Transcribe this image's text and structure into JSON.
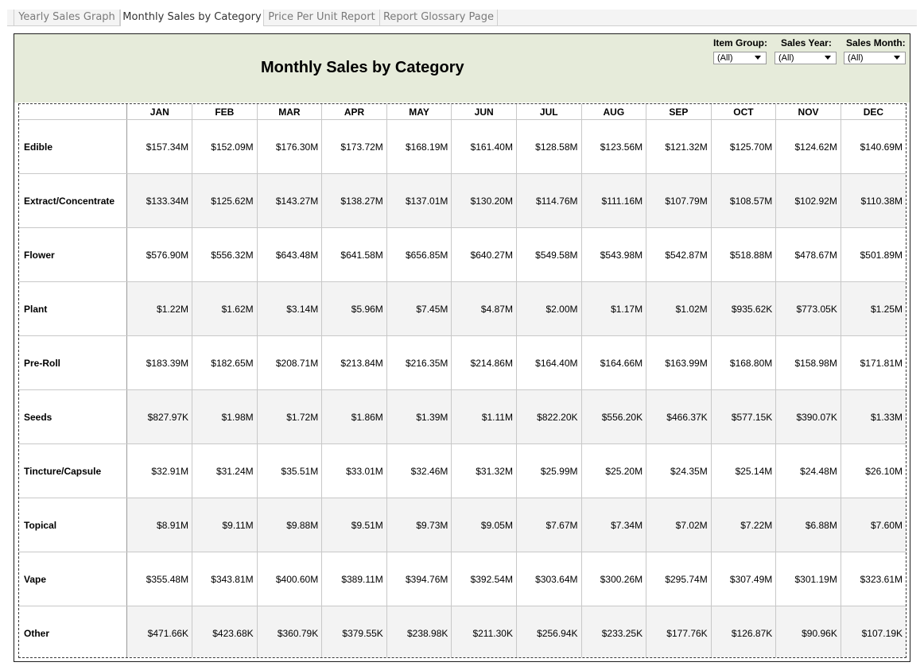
{
  "tabs": [
    {
      "label": "Yearly Sales Graph",
      "active": false
    },
    {
      "label": "Monthly Sales by Category",
      "active": true
    },
    {
      "label": "Price Per Unit Report",
      "active": false
    },
    {
      "label": "Report Glossary Page",
      "active": false
    }
  ],
  "dashboard": {
    "title": "Monthly Sales by Category",
    "header_bg": "#e6ebda",
    "filters": [
      {
        "label": "Item Group:",
        "value": "(All)"
      },
      {
        "label": "Sales Year:",
        "value": "(All)"
      },
      {
        "label": "Sales Month:",
        "value": "(All)"
      }
    ]
  },
  "table": {
    "columns": [
      "JAN",
      "FEB",
      "MAR",
      "APR",
      "MAY",
      "JUN",
      "JUL",
      "AUG",
      "SEP",
      "OCT",
      "NOV",
      "DEC"
    ],
    "rows": [
      {
        "category": "Edible",
        "values": [
          "$157.34M",
          "$152.09M",
          "$176.30M",
          "$173.72M",
          "$168.19M",
          "$161.40M",
          "$128.58M",
          "$123.56M",
          "$121.32M",
          "$125.70M",
          "$124.62M",
          "$140.69M"
        ]
      },
      {
        "category": "Extract/Concentrate",
        "values": [
          "$133.34M",
          "$125.62M",
          "$143.27M",
          "$138.27M",
          "$137.01M",
          "$130.20M",
          "$114.76M",
          "$111.16M",
          "$107.79M",
          "$108.57M",
          "$102.92M",
          "$110.38M"
        ]
      },
      {
        "category": "Flower",
        "values": [
          "$576.90M",
          "$556.32M",
          "$643.48M",
          "$641.58M",
          "$656.85M",
          "$640.27M",
          "$549.58M",
          "$543.98M",
          "$542.87M",
          "$518.88M",
          "$478.67M",
          "$501.89M"
        ]
      },
      {
        "category": "Plant",
        "values": [
          "$1.22M",
          "$1.62M",
          "$3.14M",
          "$5.96M",
          "$7.45M",
          "$4.87M",
          "$2.00M",
          "$1.17M",
          "$1.02M",
          "$935.62K",
          "$773.05K",
          "$1.25M"
        ]
      },
      {
        "category": "Pre-Roll",
        "values": [
          "$183.39M",
          "$182.65M",
          "$208.71M",
          "$213.84M",
          "$216.35M",
          "$214.86M",
          "$164.40M",
          "$164.66M",
          "$163.99M",
          "$168.80M",
          "$158.98M",
          "$171.81M"
        ]
      },
      {
        "category": "Seeds",
        "values": [
          "$827.97K",
          "$1.98M",
          "$1.72M",
          "$1.86M",
          "$1.39M",
          "$1.11M",
          "$822.20K",
          "$556.20K",
          "$466.37K",
          "$577.15K",
          "$390.07K",
          "$1.33M"
        ]
      },
      {
        "category": "Tincture/Capsule",
        "values": [
          "$32.91M",
          "$31.24M",
          "$35.51M",
          "$33.01M",
          "$32.46M",
          "$31.32M",
          "$25.99M",
          "$25.20M",
          "$24.35M",
          "$25.14M",
          "$24.48M",
          "$26.10M"
        ]
      },
      {
        "category": "Topical",
        "values": [
          "$8.91M",
          "$9.11M",
          "$9.88M",
          "$9.51M",
          "$9.73M",
          "$9.05M",
          "$7.67M",
          "$7.34M",
          "$7.02M",
          "$7.22M",
          "$6.88M",
          "$7.60M"
        ]
      },
      {
        "category": "Vape",
        "values": [
          "$355.48M",
          "$343.81M",
          "$400.60M",
          "$389.11M",
          "$394.76M",
          "$392.54M",
          "$303.64M",
          "$300.26M",
          "$295.74M",
          "$307.49M",
          "$301.19M",
          "$323.61M"
        ]
      },
      {
        "category": "Other",
        "values": [
          "$471.66K",
          "$423.68K",
          "$360.79K",
          "$379.55K",
          "$238.98K",
          "$211.30K",
          "$256.94K",
          "$233.25K",
          "$177.76K",
          "$126.87K",
          "$90.96K",
          "$107.19K"
        ]
      }
    ]
  }
}
